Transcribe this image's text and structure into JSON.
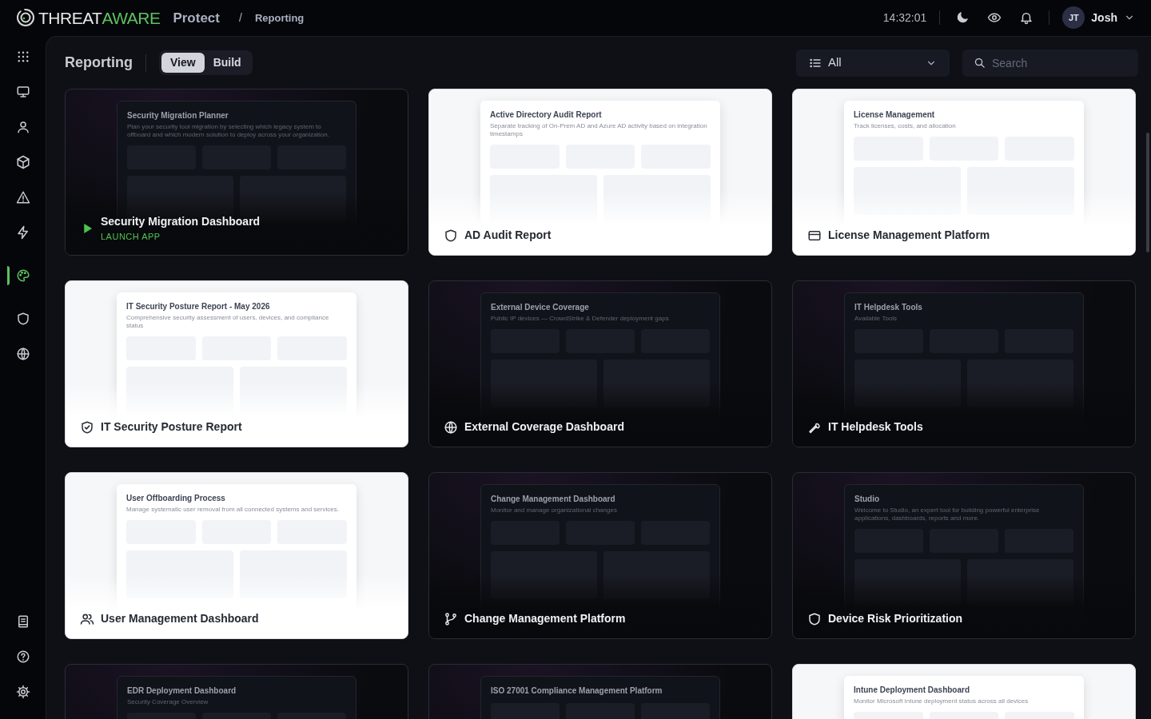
{
  "header": {
    "brand_left": "THREAT",
    "brand_right": "AWARE",
    "product": "Protect",
    "separator": "/",
    "breadcrumb": "Reporting",
    "time": "14:32:01",
    "user_initials": "JT",
    "user_name": "Josh"
  },
  "sidebar": {
    "items": [
      {
        "kind": "apps",
        "selected": false
      },
      {
        "kind": "monitor",
        "selected": false
      },
      {
        "kind": "user",
        "selected": false
      },
      {
        "kind": "cube",
        "selected": false
      },
      {
        "kind": "warning",
        "selected": false
      },
      {
        "kind": "bolt",
        "selected": false
      },
      {
        "kind": "palette",
        "selected": true
      },
      {
        "kind": "shield",
        "selected": false
      },
      {
        "kind": "globe",
        "selected": false
      }
    ],
    "bottom_items": [
      {
        "kind": "book",
        "selected": false
      },
      {
        "kind": "help",
        "selected": false
      },
      {
        "kind": "settings",
        "selected": false
      }
    ]
  },
  "page": {
    "title": "Reporting",
    "modes": [
      {
        "label": "View",
        "selected": true
      },
      {
        "label": "Build",
        "selected": false
      }
    ],
    "filter": {
      "value": "All"
    },
    "search": {
      "placeholder": "Search"
    }
  },
  "cards": [
    {
      "title": "Security Migration Dashboard",
      "kind": "dark",
      "launch": "LAUNCH APP",
      "preview": {
        "heading": "Security Migration Planner",
        "subtitle": "Plan your security tool migration by selecting which legacy system to offboard and which modern solution to deploy across your organization."
      }
    },
    {
      "title": "AD Audit Report",
      "kind": "light",
      "preview": {
        "heading": "Active Directory Audit Report",
        "subtitle": "Separate tracking of On-Prem AD and Azure AD activity based on integration timestamps"
      }
    },
    {
      "title": "License Management Platform",
      "kind": "light",
      "preview": {
        "heading": "License Management",
        "subtitle": "Track licenses, costs, and allocation"
      }
    },
    {
      "title": "IT Security Posture Report",
      "kind": "light",
      "preview": {
        "heading": "IT Security Posture Report - May 2026",
        "subtitle": "Comprehensive security assessment of users, devices, and compliance status"
      }
    },
    {
      "title": "External Coverage Dashboard",
      "kind": "dark",
      "preview": {
        "heading": "External Device Coverage",
        "subtitle": "Public IP devices — CrowdStrike & Defender deployment gaps"
      }
    },
    {
      "title": "IT Helpdesk Tools",
      "kind": "dark",
      "preview": {
        "heading": "IT Helpdesk Tools",
        "subtitle": "Available Tools"
      }
    },
    {
      "title": "User Management Dashboard",
      "kind": "light",
      "preview": {
        "heading": "User Offboarding Process",
        "subtitle": "Manage systematic user removal from all connected systems and services."
      }
    },
    {
      "title": "Change Management Platform",
      "kind": "dark",
      "preview": {
        "heading": "Change Management Dashboard",
        "subtitle": "Monitor and manage organizational changes"
      }
    },
    {
      "title": "Device Risk Prioritization",
      "kind": "dark",
      "preview": {
        "heading": "Studio",
        "subtitle": "Welcome to Studio, an expert tool for building powerful enterprise applications, dashboards, reports and more."
      }
    },
    {
      "kind": "dark",
      "preview": {
        "heading": "EDR Deployment Dashboard",
        "subtitle": "Security Coverage Overview"
      }
    },
    {
      "kind": "dark",
      "preview": {
        "heading": "ISO 27001 Compliance Management Platform"
      }
    },
    {
      "kind": "light",
      "preview": {
        "heading": "Intune Deployment Dashboard",
        "subtitle": "Monitor Microsoft Intune deployment status across all devices"
      }
    }
  ]
}
